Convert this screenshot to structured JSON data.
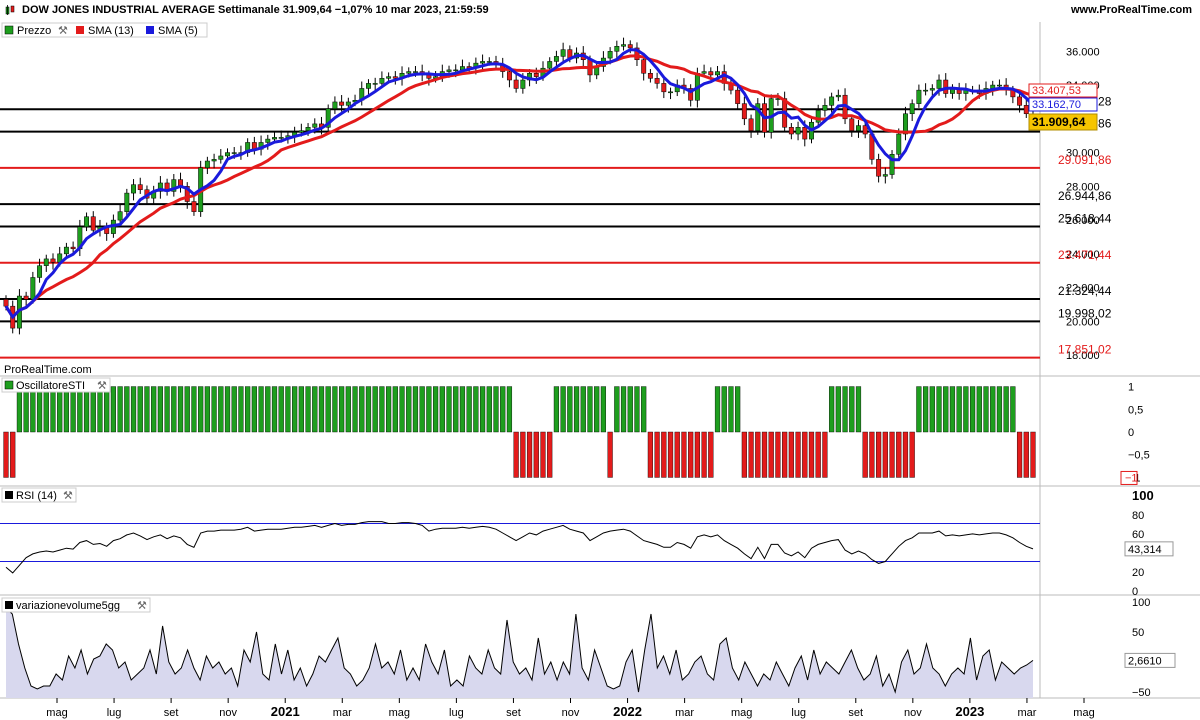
{
  "header": {
    "title": "DOW JONES INDUSTRIAL AVERAGE Settimanale 31.909,64 −1,07% 10 mar 2023, 21:59:59",
    "site": "www.ProRealTime.com",
    "icon": "candlestick-icon"
  },
  "watermark": "ProRealTime.com",
  "legend": {
    "price": "Prezzo",
    "sma13": "SMA (13)",
    "sma5": "SMA (5)"
  },
  "panels": {
    "sti": "OscillatoreSTI",
    "rsi": "RSI (14)",
    "vol": "variazionevolume5gg"
  },
  "colors": {
    "up": "#1e9e1e",
    "down": "#e31b1b",
    "sma13": "#e31b1b",
    "sma5": "#1a1adc",
    "volume_fill": "#d8d8ee",
    "last_price_bg": "#f6c500"
  },
  "chart_data": [
    {
      "type": "candlestick",
      "title": "DOW JONES INDUSTRIAL AVERAGE Settimanale",
      "ylim": [
        17000,
        37500
      ],
      "y_ticks": [
        "36.000",
        "34.000",
        "30.000",
        "28.000",
        "26.000",
        "24.000",
        "22.000",
        "20.000",
        "18.000"
      ],
      "x_ticks": [
        "mag",
        "lug",
        "set",
        "nov",
        "2021",
        "mar",
        "mag",
        "lug",
        "set",
        "nov",
        "2022",
        "mar",
        "mag",
        "lug",
        "set",
        "nov",
        "2023",
        "mar",
        "mag"
      ],
      "closes": [
        20900,
        19600,
        21500,
        21300,
        22600,
        23300,
        23700,
        23500,
        24000,
        24400,
        24300,
        25600,
        26200,
        25400,
        25600,
        25200,
        26000,
        26500,
        27600,
        28100,
        27800,
        27300,
        27700,
        28200,
        27700,
        28400,
        28000,
        27100,
        26500,
        29100,
        29500,
        29600,
        29800,
        30000,
        30000,
        30000,
        30600,
        30200,
        30600,
        30800,
        30900,
        30900,
        31000,
        31200,
        31300,
        31500,
        31700,
        31500,
        32600,
        33000,
        32800,
        33000,
        33100,
        33800,
        34100,
        34100,
        34400,
        34500,
        34400,
        34700,
        34800,
        34800,
        34600,
        34400,
        34500,
        34800,
        34900,
        34900,
        35100,
        35000,
        35300,
        35400,
        35400,
        35200,
        34800,
        34300,
        33800,
        34300,
        34700,
        34500,
        35000,
        35400,
        35700,
        36100,
        35600,
        35900,
        35500,
        34600,
        35100,
        35600,
        36000,
        36300,
        36400,
        36200,
        35500,
        34700,
        34400,
        34100,
        33600,
        33600,
        34000,
        33800,
        33100,
        34700,
        34800,
        34600,
        34800,
        34100,
        33700,
        32900,
        32000,
        31300,
        32900,
        31200,
        33200,
        33200,
        31500,
        31100,
        31500,
        30800,
        31800,
        32500,
        32800,
        33300,
        33400,
        32000,
        31300,
        31600,
        31100,
        29600,
        28600,
        28700,
        29900,
        31100,
        32300,
        32900,
        33700,
        33700,
        33800,
        34300,
        33500,
        33800,
        33500,
        33700,
        33700,
        33500,
        33800,
        34000,
        34000,
        33700,
        33300,
        32800,
        32300,
        31900
      ],
      "support_levels": [
        {
          "value": 32565.28,
          "label": "32.565,28",
          "color": "#000000"
        },
        {
          "value": 31238.86,
          "label": "31.238,86",
          "color": "#000000"
        },
        {
          "value": 29091.86,
          "label": "29.091,86",
          "color": "#e31b1b"
        },
        {
          "value": 26944.86,
          "label": "26.944,86",
          "color": "#000000"
        },
        {
          "value": 25618.44,
          "label": "25.618,44",
          "color": "#000000"
        },
        {
          "value": 23471.44,
          "label": "23.471,44",
          "color": "#e31b1b"
        },
        {
          "value": 21324.44,
          "label": "21.324,44",
          "color": "#000000"
        },
        {
          "value": 19998.02,
          "label": "19.998,02",
          "color": "#000000"
        },
        {
          "value": 17851.02,
          "label": "17.851,02",
          "color": "#e31b1b"
        }
      ],
      "last_values": [
        {
          "label": "33.407,53",
          "value": 33407.53,
          "color": "#e31b1b"
        },
        {
          "label": "33.162,70",
          "value": 33162.7,
          "color": "#1a1adc"
        },
        {
          "label": "31.909,64",
          "value": 31909.64,
          "color": "#000000"
        }
      ]
    },
    {
      "type": "bar",
      "name": "OscillatoreSTI",
      "ylim": [
        -1.1,
        1.1
      ],
      "y_ticks": [
        "1",
        "0,5",
        "0",
        "−0,5",
        "−1"
      ],
      "last_value": "−1"
    },
    {
      "type": "line",
      "name": "RSI (14)",
      "ylim": [
        0,
        100
      ],
      "y_ticks": [
        "100",
        "80",
        "60",
        "20",
        "0"
      ],
      "bands": [
        70,
        30
      ],
      "values": [
        24,
        18,
        26,
        34,
        38,
        40,
        41,
        40,
        42,
        44,
        43,
        50,
        52,
        48,
        49,
        46,
        52,
        54,
        58,
        60,
        57,
        53,
        56,
        58,
        54,
        57,
        55,
        48,
        45,
        60,
        62,
        62,
        63,
        63,
        63,
        64,
        66,
        62,
        63,
        64,
        64,
        64,
        65,
        66,
        66,
        67,
        68,
        66,
        68,
        70,
        68,
        69,
        69,
        71,
        72,
        72,
        72,
        70,
        70,
        71,
        71,
        70,
        68,
        62,
        64,
        65,
        65,
        65,
        66,
        65,
        66,
        67,
        66,
        64,
        60,
        56,
        52,
        56,
        60,
        58,
        62,
        64,
        66,
        68,
        64,
        62,
        60,
        52,
        56,
        60,
        62,
        63,
        64,
        62,
        57,
        52,
        50,
        48,
        45,
        45,
        50,
        48,
        44,
        56,
        58,
        56,
        58,
        52,
        48,
        44,
        38,
        33,
        45,
        33,
        48,
        48,
        39,
        36,
        40,
        34,
        44,
        48,
        50,
        52,
        53,
        42,
        38,
        41,
        38,
        32,
        28,
        30,
        38,
        46,
        52,
        55,
        60,
        60,
        60,
        62,
        57,
        58,
        57,
        58,
        59,
        58,
        59,
        60,
        60,
        58,
        55,
        50,
        46,
        43.314
      ],
      "last_value": "43,314"
    },
    {
      "type": "area",
      "name": "variazionevolume5gg",
      "ylim": [
        -60,
        110
      ],
      "y_ticks": [
        "100",
        "50",
        "0",
        "−50"
      ],
      "values": [
        90,
        80,
        30,
        -10,
        -40,
        -45,
        -40,
        -40,
        -20,
        -30,
        10,
        -10,
        20,
        -20,
        5,
        10,
        30,
        20,
        -10,
        0,
        -30,
        -20,
        -10,
        20,
        -20,
        60,
        0,
        -20,
        -10,
        20,
        -10,
        -30,
        10,
        -10,
        0,
        -20,
        -10,
        -40,
        20,
        0,
        50,
        -20,
        -30,
        30,
        -20,
        20,
        -30,
        -10,
        -40,
        -20,
        10,
        0,
        20,
        40,
        -10,
        -20,
        -40,
        -30,
        -10,
        30,
        -10,
        0,
        -20,
        20,
        -30,
        -10,
        -30,
        30,
        0,
        -20,
        20,
        -40,
        -30,
        -40,
        10,
        -10,
        -20,
        20,
        -10,
        -20,
        70,
        0,
        -20,
        -10,
        -30,
        40,
        -20,
        0,
        -30,
        0,
        -20,
        80,
        -10,
        -30,
        20,
        -10,
        -40,
        -45,
        -40,
        0,
        20,
        -50,
        20,
        80,
        -10,
        10,
        -20,
        20,
        -30,
        -20,
        0,
        10,
        -20,
        -30,
        30,
        40,
        -10,
        -30,
        0,
        -20,
        -40,
        -20,
        -30,
        0,
        -20,
        -40,
        -10,
        10,
        -30,
        20,
        -20,
        0,
        -10,
        -20,
        0,
        20,
        -10,
        -30,
        -20,
        10,
        -40,
        -20,
        -50,
        0,
        20,
        -20,
        -10,
        30,
        -10,
        -20,
        -40,
        -20,
        -10,
        -20,
        40,
        -30,
        10,
        20,
        -30,
        0,
        -10,
        -20,
        -10,
        -5,
        2.661
      ],
      "last_value": "2,6610"
    }
  ]
}
